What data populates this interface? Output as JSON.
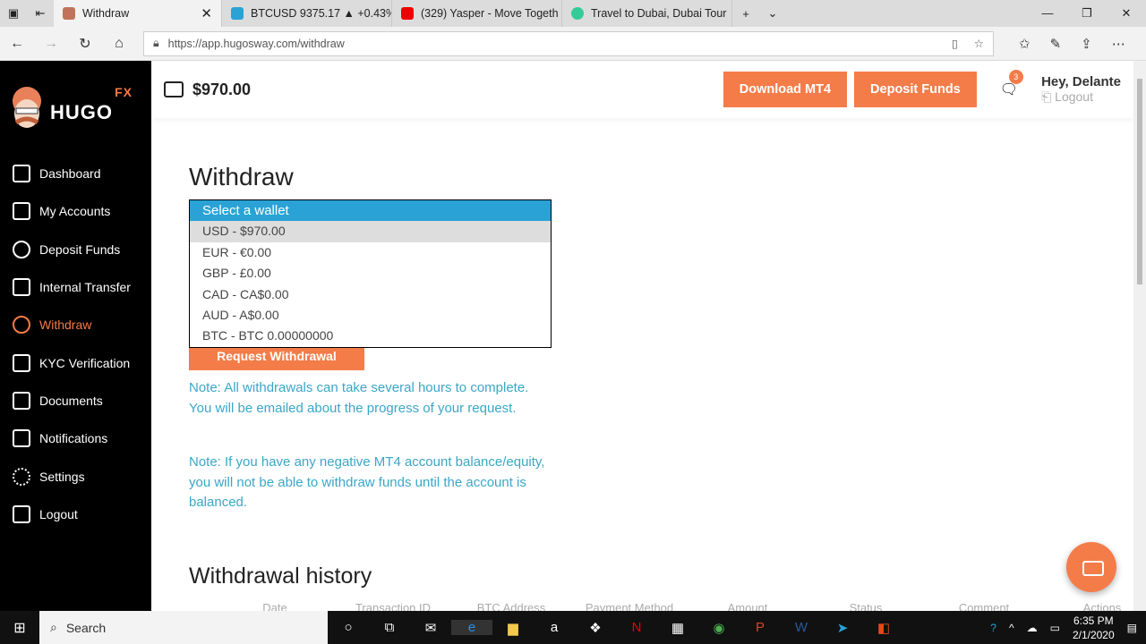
{
  "browser": {
    "tabs": [
      {
        "title": "Withdraw",
        "active": true,
        "favicon_color": "#c0735a"
      },
      {
        "title": "BTCUSD 9375.17 ▲ +0.43%",
        "favicon_color": "#2aa2d6"
      },
      {
        "title": "(329) Yasper - Move Togeth",
        "favicon_color": "#e00"
      },
      {
        "title": "Travel to Dubai, Dubai Tour",
        "favicon_color": "#3c9"
      }
    ],
    "url": "https://app.hugosway.com/withdraw"
  },
  "brand": {
    "name": "HUGO",
    "suffix": "FX",
    "accent": "#f47c48"
  },
  "sidebar": {
    "items": [
      {
        "label": "Dashboard"
      },
      {
        "label": "My Accounts"
      },
      {
        "label": "Deposit Funds"
      },
      {
        "label": "Internal Transfer"
      },
      {
        "label": "Withdraw",
        "active": true
      },
      {
        "label": "KYC Verification"
      },
      {
        "label": "Documents"
      },
      {
        "label": "Notifications"
      },
      {
        "label": "Settings"
      },
      {
        "label": "Logout"
      }
    ]
  },
  "header": {
    "balance": "$970.00",
    "download_label": "Download MT4",
    "deposit_label": "Deposit Funds",
    "notif_count": "3",
    "greeting": "Hey, Delante",
    "logout": "Logout"
  },
  "main": {
    "title": "Withdraw",
    "select": {
      "options": [
        "Select a wallet",
        "USD - $970.00",
        "EUR - €0.00",
        "GBP - £0.00",
        "CAD - CA$0.00",
        "AUD - A$0.00",
        "BTC - BTC 0.00000000"
      ]
    },
    "request_label": "Request Withdrawal",
    "note1": "Note: All withdrawals can take several hours to complete. You will be emailed about the progress of your request.",
    "note2": "Note: If you have any negative MT4 account balance/equity, you will not be able to withdraw funds until the account is balanced.",
    "history_title": "Withdrawal history",
    "columns": [
      "Date",
      "Transaction ID",
      "BTC Address",
      "Payment Method",
      "Amount",
      "Status",
      "Comment",
      "Actions"
    ]
  },
  "taskbar": {
    "search": "Search",
    "time": "6:35 PM",
    "date": "2/1/2020"
  }
}
